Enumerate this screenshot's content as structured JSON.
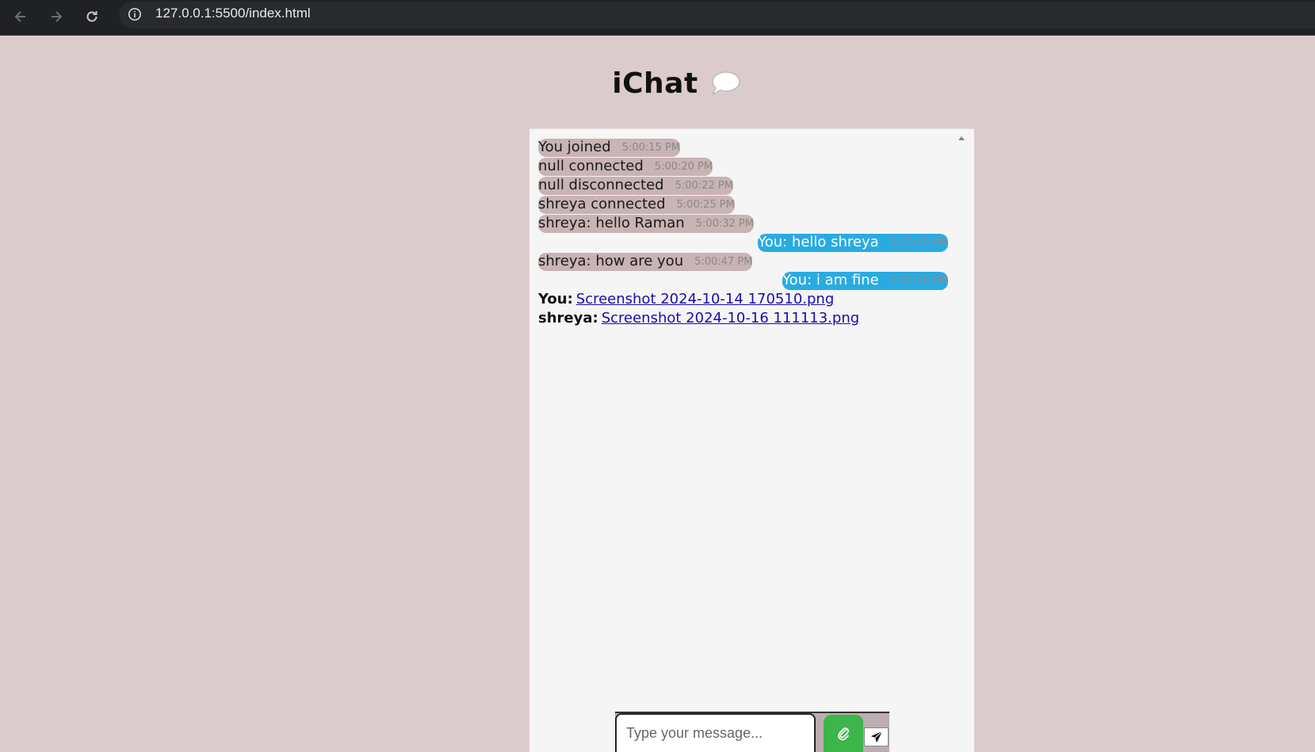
{
  "browser": {
    "url": "127.0.0.1:5500/index.html"
  },
  "app": {
    "title": "iChat"
  },
  "messages": [
    {
      "side": "left",
      "text": "You joined",
      "time": "5:00:15 PM"
    },
    {
      "side": "left",
      "text": "null connected",
      "time": "5:00:20 PM"
    },
    {
      "side": "left",
      "text": "null disconnected",
      "time": "5:00:22 PM"
    },
    {
      "side": "left",
      "text": "shreya connected",
      "time": "5:00:25 PM"
    },
    {
      "side": "left",
      "text": "shreya: hello Raman",
      "time": "5:00:32 PM"
    },
    {
      "side": "right",
      "text": "You: hello shreya",
      "time": "5:00:40 PM"
    },
    {
      "side": "left",
      "text": "shreya: how are you",
      "time": "5:00:47 PM"
    },
    {
      "side": "right",
      "text": "You: i am fine",
      "time": "5:00:58 PM"
    }
  ],
  "files": [
    {
      "sender": "You:",
      "filename": "Screenshot 2024-10-14 170510.png"
    },
    {
      "sender": "shreya:",
      "filename": "Screenshot 2024-10-16 111113.png"
    }
  ],
  "input": {
    "placeholder": "Type your message...",
    "value": ""
  },
  "colors": {
    "page_bg": "#dccbcc",
    "bubble_incoming": "#c9b3b4",
    "bubble_outgoing": "#29abe2",
    "attach_button": "#3cb54a"
  }
}
